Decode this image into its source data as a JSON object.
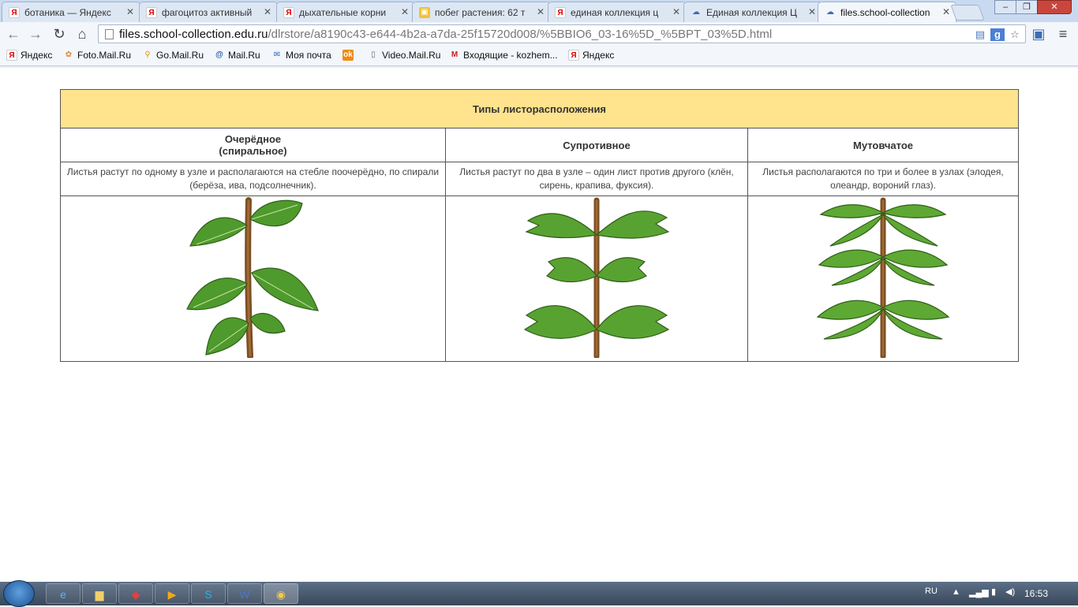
{
  "browser": {
    "tabs": [
      {
        "label": "ботаника — Яндекс",
        "icon": "yandex"
      },
      {
        "label": "фагоцитоз активный",
        "icon": "yandex"
      },
      {
        "label": "дыхательные корни",
        "icon": "yandex"
      },
      {
        "label": "побег растения: 62 т",
        "icon": "presentation"
      },
      {
        "label": "единая коллекция ц",
        "icon": "yandex"
      },
      {
        "label": "Единая коллекция Ц",
        "icon": "cloud"
      },
      {
        "label": "files.school-collection",
        "icon": "cloud"
      }
    ],
    "url_host": "files.school-collection.edu.ru",
    "url_path": "/dlrstore/a8190c43-e644-4b2a-a7da-25f15720d008/%5BBIO6_03-16%5D_%5BPT_03%5D.html",
    "bookmarks": [
      {
        "label": "Яндекс",
        "icon": "yandex"
      },
      {
        "label": "Foto.Mail.Ru",
        "icon": "flower"
      },
      {
        "label": "Go.Mail.Ru",
        "icon": "magnifier"
      },
      {
        "label": "Mail.Ru",
        "icon": "at"
      },
      {
        "label": "Моя почта",
        "icon": "envelope"
      },
      {
        "label": "",
        "icon": "odnoklassniki"
      },
      {
        "label": "Video.Mail.Ru",
        "icon": "page"
      },
      {
        "label": "Входящие - kozhem...",
        "icon": "gmail"
      },
      {
        "label": "Яндекс",
        "icon": "yandex"
      }
    ]
  },
  "table": {
    "title": "Типы листорасположения",
    "columns": [
      {
        "heading": "Очерёдное",
        "subheading": "(спиральное)",
        "description": "Листья растут по одному в узле и располагаются на стебле поочерёдно, по спирали (берёза, ива, подсолнечник).",
        "image": "alternate-leaf-plant"
      },
      {
        "heading": "Супротивное",
        "subheading": "",
        "description": "Листья растут по два в узле – один лист против другого (клён, сирень, крапива, фуксия).",
        "image": "opposite-leaf-plant"
      },
      {
        "heading": "Мутовчатое",
        "subheading": "",
        "description": "Листья располагаются по три и более в узлах (элодея, олеандр, вороний глаз).",
        "image": "whorled-leaf-plant"
      }
    ]
  },
  "taskbar": {
    "language": "RU",
    "time": "16:53"
  },
  "colors": {
    "header_bg": "#ffe38d",
    "leaf": "#4f9a2c",
    "stem": "#8a5a2b"
  }
}
